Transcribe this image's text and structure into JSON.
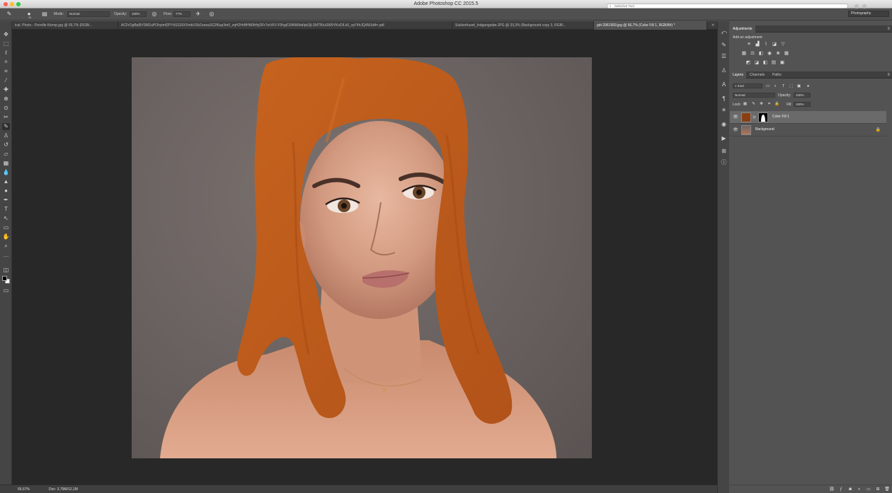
{
  "window": {
    "title": "Adobe Photoshop CC 2015.5",
    "search_placeholder": "Selective Tool",
    "workspace": "Photography"
  },
  "options_bar": {
    "mode_label": "Mode:",
    "mode_value": "Normal",
    "opacity_label": "Opacity:",
    "opacity_value": "100%",
    "flow_label": "Flow:",
    "flow_value": "77%",
    "brush_size": "15"
  },
  "tabs": [
    {
      "label": "ical. Photo - Pernille Klemp.jpg @ 66,7% (RGB/..."
    },
    {
      "label": "ACFrOgBq9lVSM2uPOhytmf2PYkSSJ9XXmkUSb2oeea3G2f6up3m0_zqH2HrBHN0frftyDFr7wVKV-F0hgiO34NWbdIpk3jLSMTBIuSW9YKoDILk0_vp74hJQ4MJdA=.pdf"
    },
    {
      "label": "Sukkerhuset_Indgangsdør.JPG @ 33,3% (Background copy 3, RGB/..."
    },
    {
      "label": "girl-2961959.jpg @ 66,7% (Color Fill 1, RGB/8#) *"
    }
  ],
  "status": {
    "zoom": "66,67%",
    "doc": "Doc: 3,79M/12,1M"
  },
  "adjustments": {
    "tab": "Adjustments",
    "add_label": "Add an adjustment"
  },
  "layers_panel": {
    "tabs": [
      "Layers",
      "Channels",
      "Paths"
    ],
    "filter": "Kind",
    "blend_mode": "Normal",
    "opacity_label": "Opacity:",
    "opacity_value": "100%",
    "lock_label": "Lock:",
    "fill_label": "Fill:",
    "fill_value": "100%",
    "layers": [
      {
        "name": "Color Fill 1",
        "selected": true,
        "color": "#8a3f13"
      },
      {
        "name": "Background",
        "selected": false,
        "locked": true
      }
    ]
  },
  "colors": {
    "hair_paint": "#c2601e",
    "skin": "#d9a58c",
    "backdrop": "#6c6462",
    "fill_swatch": "#8a3f13"
  }
}
